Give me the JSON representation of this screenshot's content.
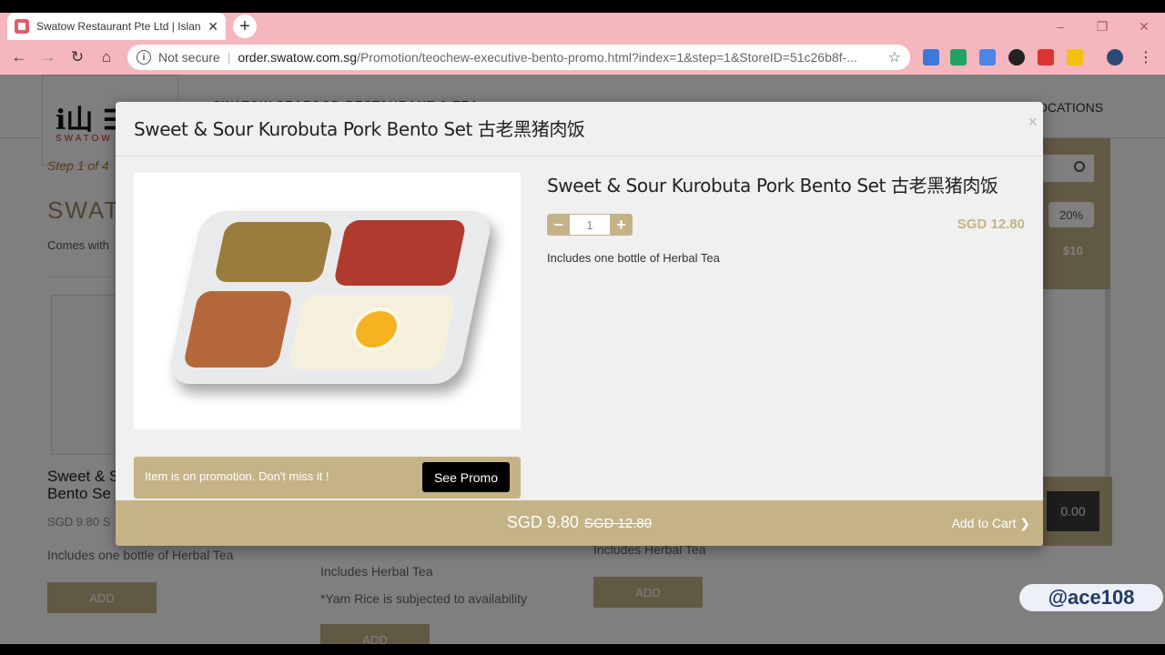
{
  "browser": {
    "tab_title": "Swatow Restaurant Pte Ltd | Islan",
    "tab_close": "✕",
    "new_tab": "+",
    "security_label": "Not secure",
    "url_host": "order.swatow.com.sg",
    "url_path": "/Promotion/teochew-executive-bento-promo.html?index=1&step=1&StoreID=51c26b8f-...",
    "window_controls": [
      "–",
      "❐",
      "✕"
    ]
  },
  "page": {
    "brand_text": "SWATOW SEAFOOD RESTAURANT & TEA",
    "logo_word": "SWATOW",
    "nav_right": "OCATIONS",
    "step_label": "Step 1 of 4",
    "section_title": "SWATO",
    "section_subtitle": "Comes with",
    "card1_name": "Sweet & S\nBento Se",
    "card1_price": "SGD 9.80 S",
    "card1_desc": "Includes one bottle of Herbal Tea",
    "card2_desc1": "Includes Herbal Tea",
    "card2_desc2": "*Yam Rice is subjected to availability",
    "card3_desc": "Includes Herbal Tea",
    "add_label": "ADD",
    "discount_badge": "20%",
    "discount_amount": "$10",
    "cart_total": "0.00"
  },
  "modal": {
    "title": "Sweet & Sour Kurobuta Pork Bento Set 古老黑猪肉饭",
    "close": "×",
    "product_name": "Sweet & Sour Kurobuta Pork Bento Set 古老黑猪肉饭",
    "quantity": "1",
    "minus": "−",
    "plus": "+",
    "price": "SGD 12.80",
    "description": "Includes one bottle of Herbal Tea",
    "promo_text": "Item is on promotion. Don't miss it !",
    "promo_button": "See Promo",
    "footer_price": "SGD 9.80",
    "footer_old_price": "SGD 12.80",
    "add_to_cart": "Add to Cart ❯"
  },
  "watermark": "@ace108",
  "colors": {
    "accent_gold": "#c5b388",
    "chrome_pink": "#f5b6bd"
  }
}
